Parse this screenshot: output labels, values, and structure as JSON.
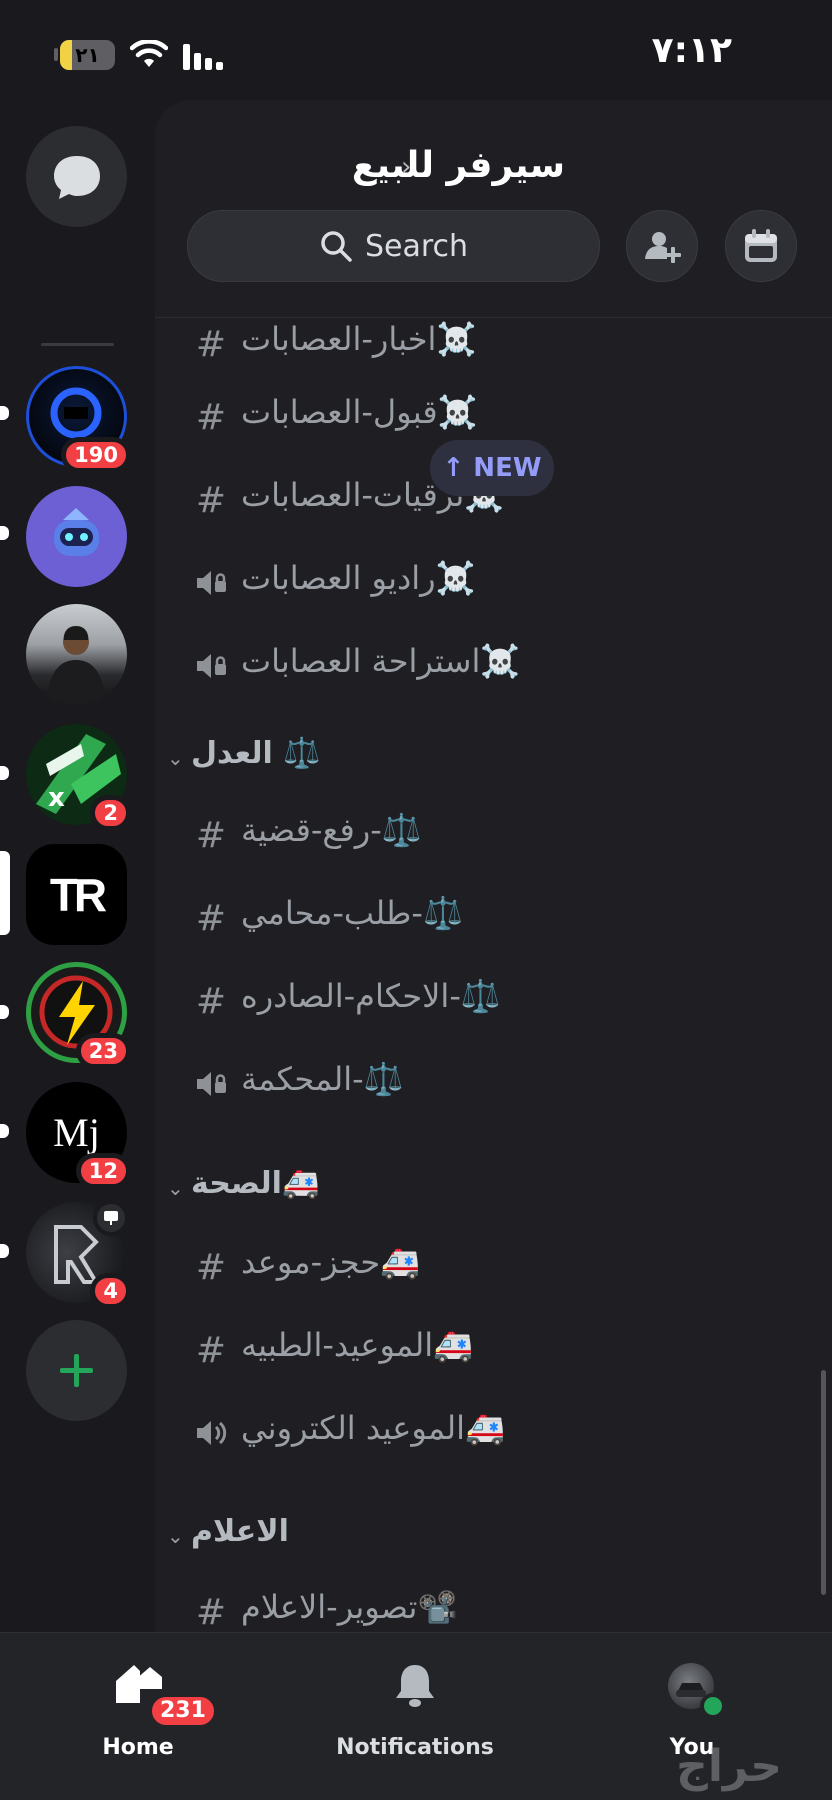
{
  "status_bar": {
    "time": "٧:١٢",
    "battery": "٢١",
    "battery_level": 0.21
  },
  "servers": [
    {
      "name": "server-1",
      "badge": "190",
      "unread": true
    },
    {
      "name": "server-2",
      "badge": "",
      "unread": true
    },
    {
      "name": "server-3",
      "badge": "",
      "unread": false
    },
    {
      "name": "server-4",
      "badge": "2",
      "unread": true
    },
    {
      "name": "server-5",
      "badge": "",
      "active": true
    },
    {
      "name": "server-6",
      "badge": "23",
      "unread": true
    },
    {
      "name": "server-7",
      "badge": "12",
      "unread": true,
      "label": "Mj"
    },
    {
      "name": "server-8",
      "badge": "4",
      "unread": true
    }
  ],
  "server_tr_label": "TR",
  "server_mj_label": "Mj",
  "header": {
    "title": "سيرفر للبيع",
    "chevron": "›"
  },
  "search": {
    "placeholder": "Search"
  },
  "new_indicator": "↑ NEW",
  "channels": [
    {
      "type": "text-locked",
      "name": "اخبار-العصابات☠️"
    },
    {
      "type": "text-locked",
      "name": "قبول-العصابات☠️"
    },
    {
      "type": "text-locked",
      "name": "ترقيات-العصابات☠️"
    },
    {
      "type": "voice-locked",
      "name": "راديو العصابات☠️"
    },
    {
      "type": "voice-locked",
      "name": "استراحة العصابات☠️"
    }
  ],
  "categories": [
    {
      "name": "العدل ⚖️",
      "channels": [
        {
          "type": "text",
          "name": "رفع-قضية-⚖️"
        },
        {
          "type": "text",
          "name": "طلب-محامي-⚖️"
        },
        {
          "type": "text",
          "name": "الاحكام-الصادره-⚖️"
        },
        {
          "type": "voice-locked",
          "name": "المحكمة-⚖️"
        }
      ]
    },
    {
      "name": "الصحة🚑",
      "channels": [
        {
          "type": "text",
          "name": "حجز-موعد🚑"
        },
        {
          "type": "text",
          "name": "الموعيد-الطبيه🚑"
        },
        {
          "type": "voice",
          "name": "الموعيد الكتروني🚑"
        }
      ]
    },
    {
      "name": "الاعلام",
      "channels": [
        {
          "type": "text",
          "name": "تصوير-الاعلام📽️"
        }
      ]
    }
  ],
  "bottom_nav": {
    "home": {
      "label": "Home",
      "badge": "231"
    },
    "notifications": {
      "label": "Notifications"
    },
    "you": {
      "label": "You"
    }
  },
  "watermark": "حراج",
  "colors": {
    "badge": "#f23f43",
    "online": "#23a55a",
    "new_pill": "#949cf7"
  }
}
